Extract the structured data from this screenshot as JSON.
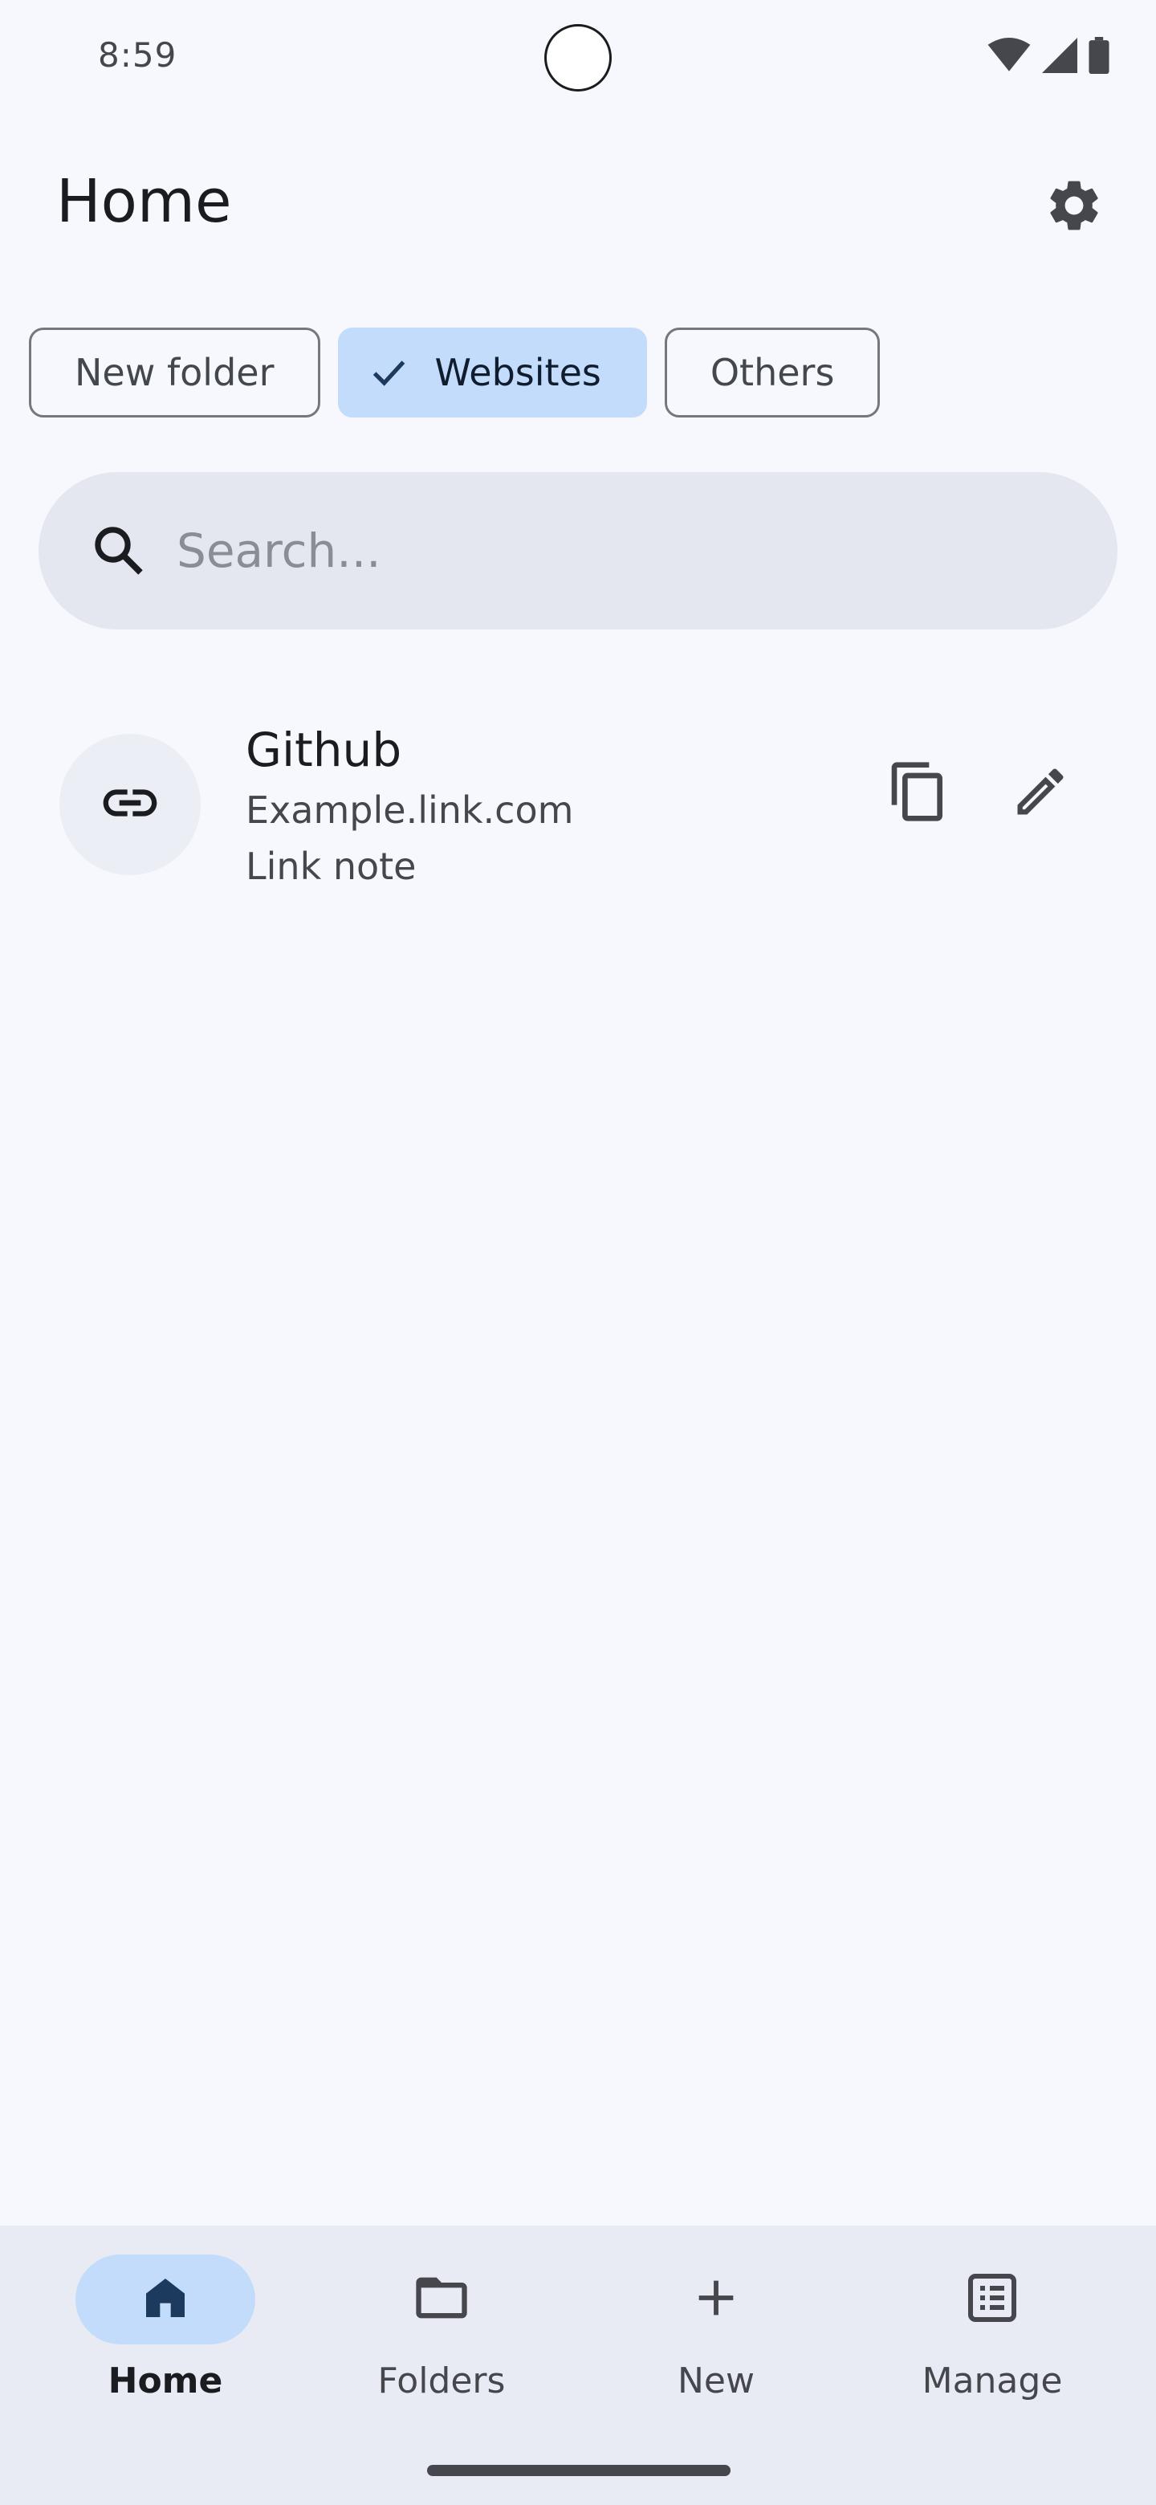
{
  "status_bar": {
    "time": "8:59",
    "icons": [
      "wifi-icon",
      "signal-icon",
      "battery-icon"
    ]
  },
  "header": {
    "title": "Home",
    "settings_icon": "gear-icon"
  },
  "chips": [
    {
      "label": "New folder",
      "selected": false
    },
    {
      "label": "Websites",
      "selected": true
    },
    {
      "label": "Others",
      "selected": false
    }
  ],
  "search": {
    "placeholder": "Search...",
    "value": ""
  },
  "links": [
    {
      "title": "Github",
      "url": "Example.link.com",
      "note": "Link note",
      "icon": "link-icon"
    }
  ],
  "bottom_nav": {
    "items": [
      {
        "label": "Home",
        "icon": "home-icon",
        "active": true
      },
      {
        "label": "Folders",
        "icon": "folder-icon",
        "active": false
      },
      {
        "label": "New",
        "icon": "plus-icon",
        "active": false
      },
      {
        "label": "Manage",
        "icon": "list-icon",
        "active": false
      }
    ]
  },
  "colors": {
    "background": "#f7f8fd",
    "accent_container": "#c4dcfb",
    "search_bg": "#e5e7f0",
    "nav_bg": "#e9ebf4",
    "active_icon": "#1c3a5e"
  }
}
